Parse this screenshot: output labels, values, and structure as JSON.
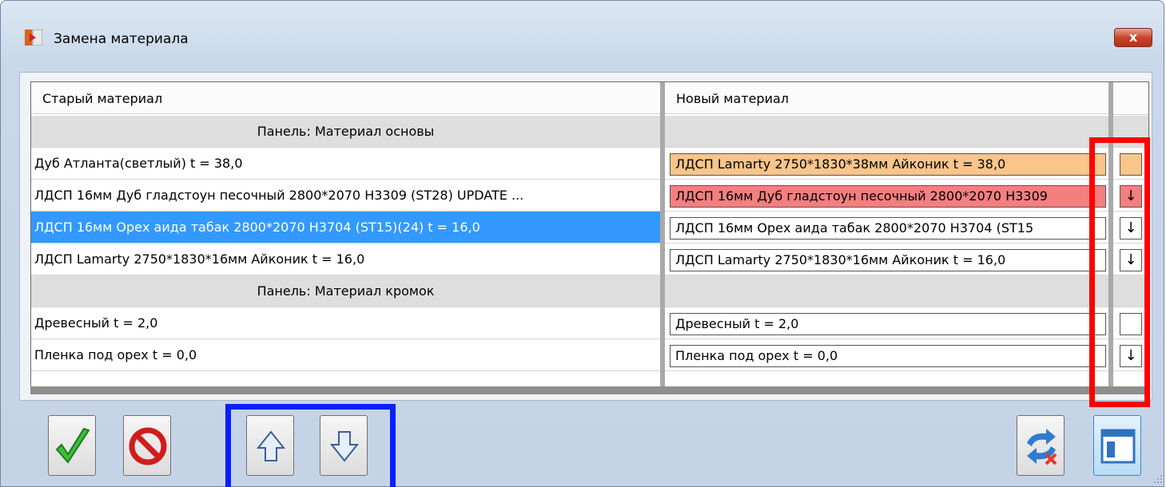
{
  "window": {
    "title": "Замена материала",
    "close_label": "x"
  },
  "table": {
    "col_old": "Старый материал",
    "col_new": "Новый материал"
  },
  "rows": [
    {
      "type": "group",
      "old": "Панель: Материал основы"
    },
    {
      "type": "item",
      "old": "Дуб Атланта(светлый) t = 38,0",
      "new": "ЛДСП Lamarty 2750*1830*38мм Айконик t = 38,0",
      "arrow": "",
      "state": "orange"
    },
    {
      "type": "item",
      "old": "ЛДСП 16мм Дуб гладстоун песочный 2800*2070 H3309 (ST28) UPDATE ...",
      "new": "ЛДСП 16мм Дуб гладстоун песочный 2800*2070 H3309",
      "arrow": "↓",
      "state": "red"
    },
    {
      "type": "item",
      "old": "ЛДСП 16мм Орех аида табак 2800*2070 H3704 (ST15)(24) t = 16,0",
      "new": "ЛДСП 16мм Орех аида табак 2800*2070 H3704 (ST15",
      "arrow": "↓",
      "state": "selected"
    },
    {
      "type": "item",
      "old": "ЛДСП Lamarty 2750*1830*16мм Айконик t = 16,0",
      "new": "ЛДСП Lamarty 2750*1830*16мм Айконик t = 16,0",
      "arrow": "↓",
      "state": "normal"
    },
    {
      "type": "group",
      "old": "Панель: Материал кромок"
    },
    {
      "type": "item",
      "old": "Древесный t = 2,0",
      "new": "Древесный t = 2,0",
      "arrow": "",
      "state": "normal"
    },
    {
      "type": "item",
      "old": "Пленка под орех t = 0,0",
      "new": "Пленка под орех t = 0,0",
      "arrow": "↓",
      "state": "normal"
    }
  ],
  "colors": {
    "orange": "#f9c58b",
    "red": "#f47f7f",
    "selected": "#3399ff",
    "highlight_red": "#ff0000",
    "highlight_blue": "#0a1eff"
  }
}
